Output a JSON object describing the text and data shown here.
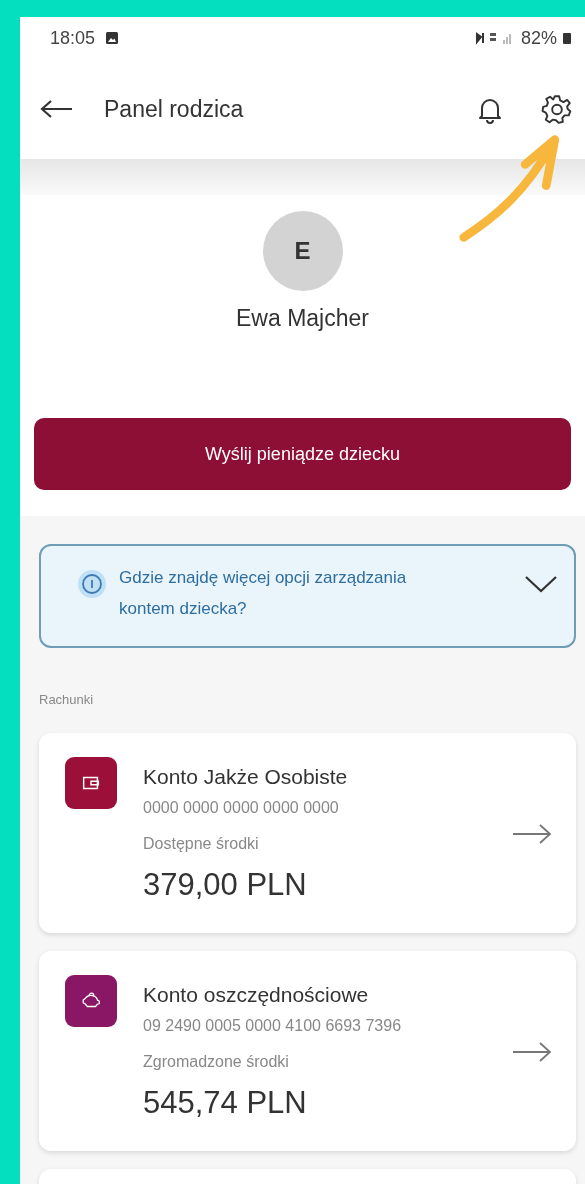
{
  "status_bar": {
    "time": "18:05",
    "battery": "82%"
  },
  "header": {
    "title": "Panel rodzica"
  },
  "profile": {
    "initial": "E",
    "name": "Ewa Majcher"
  },
  "send_button": {
    "label": "Wyślij pieniądze dziecku"
  },
  "info_box": {
    "text": "Gdzie znajdę więcej opcji zarządzania kontem dziecka?",
    "expanded": false
  },
  "section_title": "Rachunki",
  "accounts": [
    {
      "kind": "wallet",
      "color": "#9b0f38",
      "name": "Konto Jakże Osobiste",
      "number": "0000 0000 0000 0000 0000",
      "balance_label": "Dostępne środki",
      "balance": "379,00 PLN"
    },
    {
      "kind": "piggy",
      "color": "#8a1766",
      "name": "Konto oszczędnościowe",
      "number": "09 2490 0005 0000 4100 6693 7396",
      "balance_label": "Zgromadzone środki",
      "balance": "545,74 PLN"
    }
  ]
}
